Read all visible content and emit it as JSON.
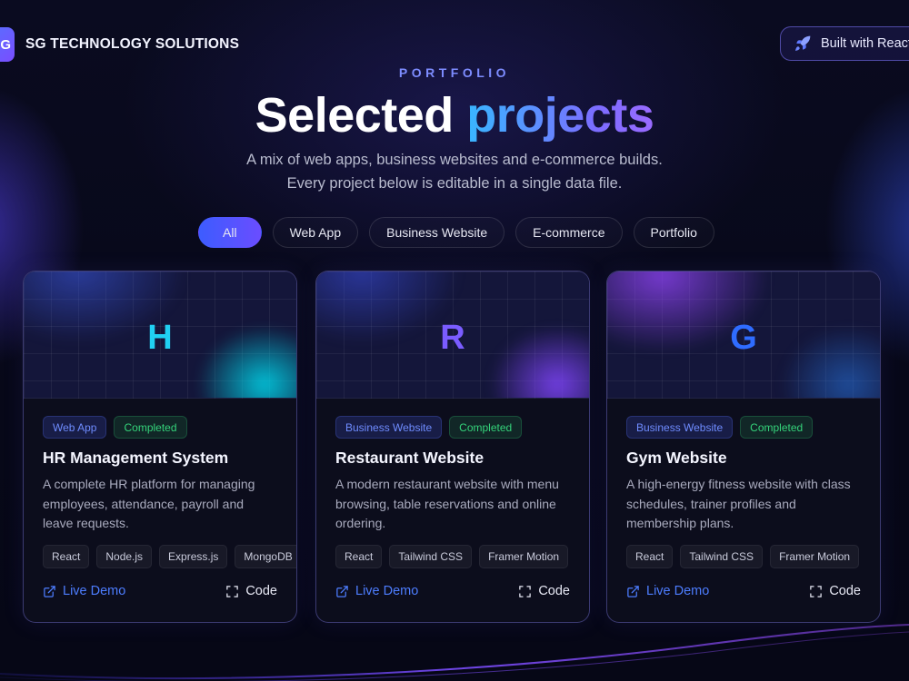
{
  "brand": {
    "mark": "G",
    "name": "SG TECHNOLOGY SOLUTIONS"
  },
  "header_badge": {
    "icon": "rocket-icon",
    "label": "Built with React"
  },
  "hero": {
    "eyebrow": "PORTFOLIO",
    "title_plain": "Selected",
    "title_accent": "projects",
    "subtitle_line1": "A mix of web apps, business websites and e-commerce builds.",
    "subtitle_line2": "Every project below is editable in a single data file."
  },
  "filters": [
    {
      "label": "All",
      "active": true
    },
    {
      "label": "Web App",
      "active": false
    },
    {
      "label": "Business Website",
      "active": false
    },
    {
      "label": "E-commerce",
      "active": false
    },
    {
      "label": "Portfolio",
      "active": false
    }
  ],
  "projects": [
    {
      "letter": "H",
      "category": "Web App",
      "status": "Completed",
      "title": "HR Management System",
      "description": "A complete HR platform for managing employees, attendance, payroll and leave requests.",
      "tags": [
        "React",
        "Node.js",
        "Express.js",
        "MongoDB"
      ],
      "demo_label": "Live Demo",
      "code_label": "Code",
      "accent": "#20d0f2"
    },
    {
      "letter": "R",
      "category": "Business Website",
      "status": "Completed",
      "title": "Restaurant Website",
      "description": "A modern restaurant website with menu browsing, table reservations and online ordering.",
      "tags": [
        "React",
        "Tailwind CSS",
        "Framer Motion"
      ],
      "demo_label": "Live Demo",
      "code_label": "Code",
      "accent": "#7a5cff"
    },
    {
      "letter": "G",
      "category": "Business Website",
      "status": "Completed",
      "title": "Gym Website",
      "description": "A high-energy fitness website with class schedules, trainer profiles and membership plans.",
      "tags": [
        "React",
        "Tailwind CSS",
        "Framer Motion"
      ],
      "demo_label": "Live Demo",
      "code_label": "Code",
      "accent": "#2f6cff"
    }
  ],
  "colors": {
    "background": "#070818",
    "primary": "#3d5cff",
    "link": "#4d7dff",
    "success": "#34d37a"
  }
}
